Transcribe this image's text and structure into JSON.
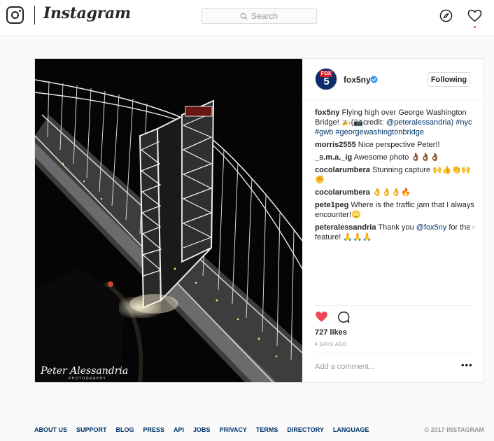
{
  "header": {
    "brand": "Instagram",
    "search_placeholder": "Search"
  },
  "post": {
    "author": {
      "username": "fox5ny",
      "avatar_line1": "FOX",
      "avatar_line2": "5",
      "verified": true
    },
    "follow_button": "Following",
    "watermark": "Peter Alessandria",
    "watermark_sub": "PHOTOGRAPHY",
    "caption": {
      "username": "fox5ny",
      "text_before": "Flying high over George Washington Bridge! 🚁(📷credit: ",
      "mention": "@peteralessandria",
      "text_after": ") ",
      "hashtags": "#nyc #gwb #georgewashingtonbridge"
    },
    "comments": [
      {
        "username": "morris2555",
        "text": "Nice perspective Peter!!"
      },
      {
        "username": "_s.m.a._ig",
        "text": "Awesome photo 👌🏾👌🏾👌🏾"
      },
      {
        "username": "cocolarumbera",
        "text": "Stunning capture 🙌👍👏🙌✊"
      },
      {
        "username": "cocolarumbera",
        "text": "👌👌👌🔥"
      },
      {
        "username": "pete1peg",
        "text": "Where is the traffic jam that I always encounter!🙄"
      },
      {
        "username": "peteralessandria",
        "text_before": "Thank you ",
        "mention": "@fox5ny",
        "text_after": " for the feature! 🙏🙏🙏",
        "close": "×"
      }
    ],
    "likes": "727 likes",
    "age": "4 DAYS AGO",
    "add_comment_placeholder": "Add a comment...",
    "more": "•••"
  },
  "footer": {
    "links": [
      "ABOUT US",
      "SUPPORT",
      "BLOG",
      "PRESS",
      "API",
      "JOBS",
      "PRIVACY",
      "TERMS",
      "DIRECTORY",
      "LANGUAGE"
    ],
    "copyright": "© 2017 INSTAGRAM"
  },
  "colors": {
    "like_red": "#ed4956",
    "link_blue": "#003569",
    "verified_blue": "#3897f0"
  }
}
